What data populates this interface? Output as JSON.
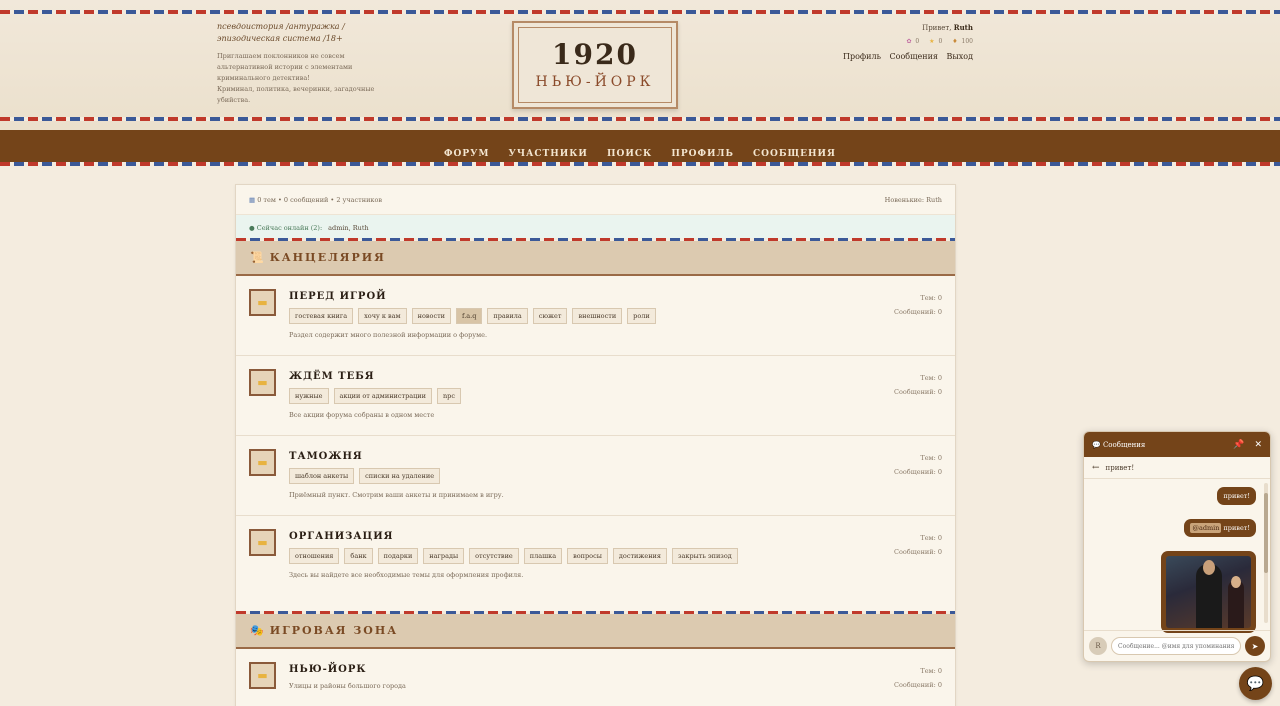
{
  "header": {
    "tags": "псевдоистория /антуражка /эпизодическая система /18+",
    "description": [
      "Приглашаем поклонников не совсем",
      "альтернативной истории с элементами",
      "криминального детектива!",
      "Криминал, политика, вечеринки, загадочные",
      "убийства."
    ],
    "logo_year": "1920",
    "logo_city": "НЬЮ-ЙОРК",
    "greeting": "Привет, ",
    "username": "Ruth",
    "stats": [
      "0",
      "0",
      "100"
    ],
    "links": [
      "Профиль",
      "Сообщения",
      "Выход"
    ]
  },
  "nav": [
    "ФОРУМ",
    "УЧАСТНИКИ",
    "ПОИСК",
    "ПРОФИЛЬ",
    "СООБЩЕНИЯ"
  ],
  "board": {
    "stats_text": "0 тем • 0 сообщений • 2 участников",
    "newest": "Новенькие: Ruth",
    "online_label": "● Сейчас онлайн (2):",
    "online_names": "admin,   Ruth"
  },
  "categories": [
    {
      "title": "КАНЦЕЛЯРИЯ",
      "forums": [
        {
          "title": "ПЕРЕД ИГРОЙ",
          "tags": [
            "гостевая книга",
            "хочу к вам",
            "новости",
            "f.a.q",
            "правила",
            "сюжет",
            "внешности",
            "роли"
          ],
          "desc": "Раздел содержит много полезной информации о форуме.",
          "topics": "Тем: 0",
          "posts": "Сообщений: 0"
        },
        {
          "title": "ЖДЁМ ТЕБЯ",
          "tags": [
            "нужные",
            "акции от администрации",
            "npc"
          ],
          "desc": "Все акции форума собраны в одном месте",
          "topics": "Тем: 0",
          "posts": "Сообщений: 0"
        },
        {
          "title": "ТАМОЖНЯ",
          "tags": [
            "шаблон анкеты",
            "списки на удаление"
          ],
          "desc": "Приёмный пункт. Смотрим ваши анкеты и принимаем в игру.",
          "topics": "Тем: 0",
          "posts": "Сообщений: 0"
        },
        {
          "title": "ОРГАНИЗАЦИЯ",
          "tags": [
            "отношения",
            "банк",
            "подарки",
            "награды",
            "отсутствие",
            "плашка",
            "вопросы",
            "достижения",
            "закрыть эпизод"
          ],
          "desc": "Здесь вы найдете все необходимые темы для оформления профиля.",
          "topics": "Тем: 0",
          "posts": "Сообщений: 0"
        }
      ]
    },
    {
      "title": "ИГРОВАЯ ЗОНА",
      "forums": [
        {
          "title": "НЬЮ-ЙОРК",
          "tags": [],
          "desc": "Улицы и районы большого города",
          "topics": "Тем: 0",
          "posts": "Сообщений: 0"
        }
      ]
    }
  ],
  "chat": {
    "title": "Сообщения",
    "conversation": "привет!",
    "messages": [
      "привет!",
      "привет!"
    ],
    "mention": "@admin",
    "input_placeholder": "Сообщение... @имя для упоминания",
    "avatar_letter": "R"
  },
  "colors": {
    "accent": "#744419",
    "airmail_red": "#c0392b",
    "airmail_blue": "#3b5998",
    "background": "#f4ecdf"
  }
}
